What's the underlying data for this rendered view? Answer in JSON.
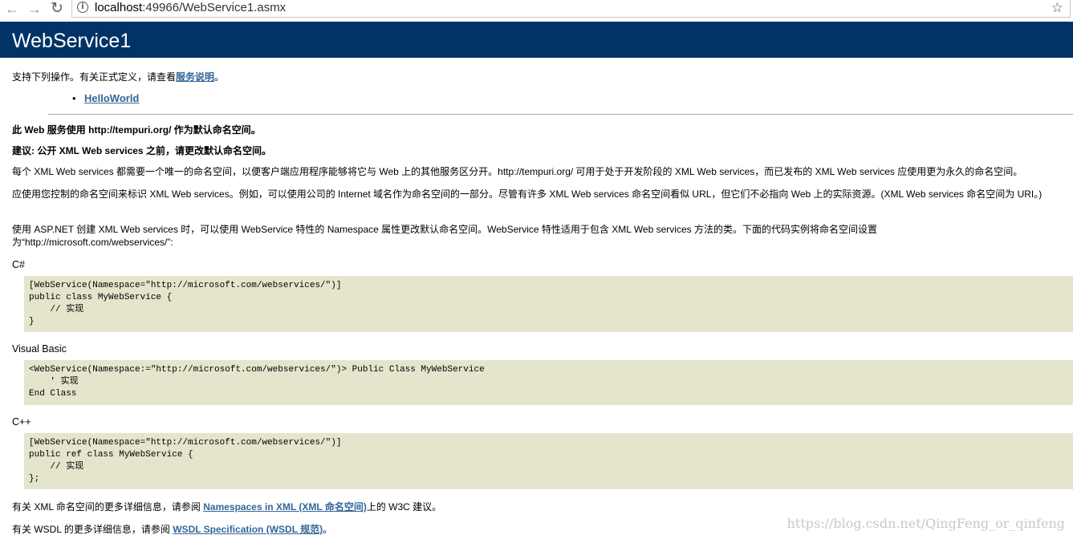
{
  "browser": {
    "url_host": "localhost",
    "url_rest": ":49966/WebService1.asmx"
  },
  "banner": {
    "title": "WebService1"
  },
  "intro": {
    "text": "支持下列操作。有关正式定义，请查看",
    "link": "服务说明",
    "suffix": "。"
  },
  "operations": [
    {
      "label": "HelloWorld"
    }
  ],
  "notes": {
    "namespace_default": "此 Web 服务使用 http://tempuri.org/ 作为默认命名空间。",
    "recommendation": "建议: 公开 XML Web services 之前，请更改默认命名空间。",
    "para1": "每个 XML Web services 都需要一个唯一的命名空间，以便客户端应用程序能够将它与 Web 上的其他服务区分开。http://tempuri.org/ 可用于处于开发阶段的 XML Web services，而已发布的 XML Web services 应使用更为永久的命名空间。",
    "para2": "应使用您控制的命名空间来标识 XML Web services。例如，可以使用公司的 Internet 域名作为命名空间的一部分。尽管有许多 XML Web services 命名空间看似 URL，但它们不必指向 Web 上的实际资源。(XML Web services 命名空间为 URI。)",
    "para3": "使用 ASP.NET 创建 XML Web services 时，可以使用 WebService 特性的 Namespace 属性更改默认命名空间。WebService 特性适用于包含 XML Web services 方法的类。下面的代码实例将命名空间设置为“http://microsoft.com/webservices/”:"
  },
  "samples": {
    "csharp": {
      "label": "C#",
      "code": "[WebService(Namespace=\"http://microsoft.com/webservices/\")]\npublic class MyWebService {\n    // 实现\n}"
    },
    "vb": {
      "label": "Visual Basic",
      "code": "<WebService(Namespace:=\"http://microsoft.com/webservices/\")> Public Class MyWebService\n    ' 实现\nEnd Class"
    },
    "cpp": {
      "label": "C++",
      "code": "[WebService(Namespace=\"http://microsoft.com/webservices/\")]\npublic ref class MyWebService {\n    // 实现\n};"
    }
  },
  "footer": {
    "xml_ns_prefix": "有关 XML 命名空间的更多详细信息，请参阅 ",
    "xml_ns_link": "Namespaces in XML (XML 命名空间)",
    "xml_ns_suffix": "上的 W3C 建议。",
    "wsdl_prefix": "有关 WSDL 的更多详细信息，请参阅 ",
    "wsdl_link": "WSDL Specification (WSDL 规范)",
    "wsdl_suffix": "。"
  },
  "watermark": "https://blog.csdn.net/QingFeng_or_qinfeng"
}
